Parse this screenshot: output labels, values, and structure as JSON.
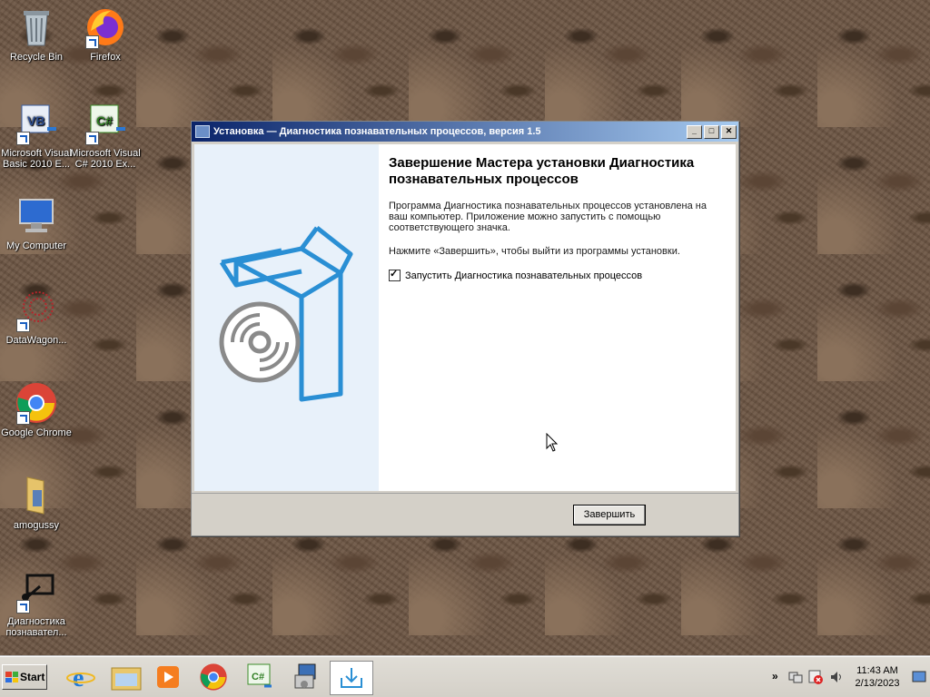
{
  "desktop": {
    "icons": [
      {
        "label": "Recycle Bin"
      },
      {
        "label": "Firefox"
      },
      {
        "label": "Microsoft Visual Basic 2010 E..."
      },
      {
        "label": "Microsoft Visual C# 2010 Ex..."
      },
      {
        "label": "My Computer"
      },
      {
        "label": "DataWagon..."
      },
      {
        "label": "Google Chrome"
      },
      {
        "label": "amogussy"
      },
      {
        "label": "Диагностика познавател..."
      }
    ]
  },
  "window": {
    "title": "Установка — Диагностика познавательных процессов, версия 1.5",
    "heading": "Завершение Мастера установки Диагностика познавательных процессов",
    "paragraph1": "Программа Диагностика познавательных процессов установлена на ваш компьютер. Приложение можно запустить с помощью соответствующего значка.",
    "paragraph2": "Нажмите «Завершить», чтобы выйти из программы установки.",
    "checkbox_label": "Запустить Диагностика познавательных процессов",
    "checkbox_checked": true,
    "finish_button": "Завершить",
    "controls": {
      "minimize": "_",
      "maximize": "□",
      "close": "✕"
    }
  },
  "taskbar": {
    "start_label": "Start",
    "items": [
      "ie-icon",
      "explorer-icon",
      "media-player-icon",
      "chrome-icon",
      "csharp-icon",
      "installer-icon",
      "setup-active-icon"
    ],
    "tray": {
      "time": "11:43 AM",
      "date": "2/13/2023",
      "expand": "»"
    }
  },
  "colors": {
    "titlebar_start": "#0a246a",
    "titlebar_end": "#a6caf0",
    "wizard_side": "#e8f1fa",
    "box_blue": "#2a8fd4"
  }
}
